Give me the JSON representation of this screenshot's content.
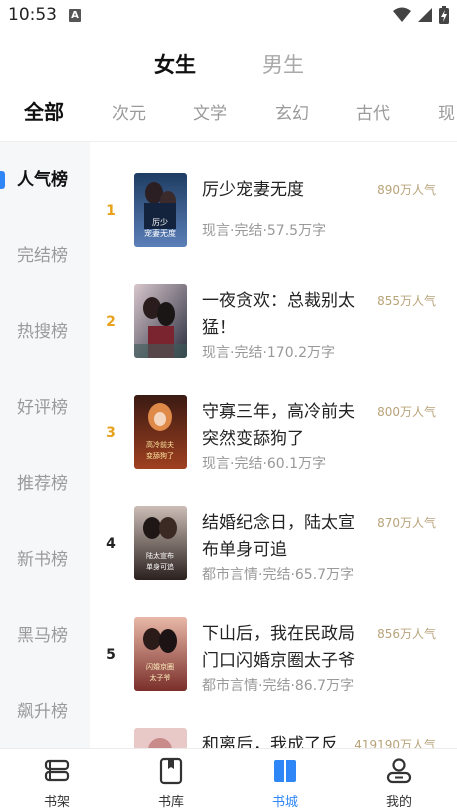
{
  "status_bar": {
    "time": "10:53",
    "a_badge": "A"
  },
  "gender_tabs": [
    {
      "label": "女生",
      "active": true
    },
    {
      "label": "男生",
      "active": false
    }
  ],
  "category_tabs": [
    "全部",
    "次元",
    "文学",
    "玄幻",
    "古代",
    "现"
  ],
  "side_nav": [
    "人气榜",
    "完结榜",
    "热搜榜",
    "好评榜",
    "推荐榜",
    "新书榜",
    "黑马榜",
    "飙升榜"
  ],
  "books": [
    {
      "rank": "1",
      "title": "厉少宠妻无度",
      "meta": "现言·完结·57.5万字",
      "popularity": "890万人气",
      "cover_text": "厉少宠妻无度"
    },
    {
      "rank": "2",
      "title": "一夜贪欢：总裁别太猛！",
      "meta": "现言·完结·170.2万字",
      "popularity": "855万人气",
      "cover_text": ""
    },
    {
      "rank": "3",
      "title": "守寡三年，高冷前夫突然变舔狗了",
      "meta": "现言·完结·60.1万字",
      "popularity": "800万人气",
      "cover_text": "高冷前夫变舔狗了"
    },
    {
      "rank": "4",
      "title": "结婚纪念日，陆太宣布单身可追",
      "meta": "都市言情·完结·65.7万字",
      "popularity": "870万人气",
      "cover_text": "陆太宣布单身可追"
    },
    {
      "rank": "5",
      "title": "下山后，我在民政局门口闪婚京圈太子爷",
      "meta": "都市言情·完结·86.7万字",
      "popularity": "856万人气",
      "cover_text": "闪婚京圈太子爷"
    },
    {
      "rank": "",
      "title": "和离后，我成了反",
      "meta": "",
      "popularity": "419190万人气",
      "cover_text": ""
    }
  ],
  "bottom_nav": [
    {
      "label": "书架",
      "icon": "bookshelf-icon",
      "active": false
    },
    {
      "label": "书库",
      "icon": "library-icon",
      "active": false
    },
    {
      "label": "书城",
      "icon": "bookstore-icon",
      "active": true
    },
    {
      "label": "我的",
      "icon": "profile-icon",
      "active": false
    }
  ],
  "colors": {
    "accent": "#2f86f6",
    "rank_top": "#e8a11a",
    "popularity": "#b8a37a"
  }
}
